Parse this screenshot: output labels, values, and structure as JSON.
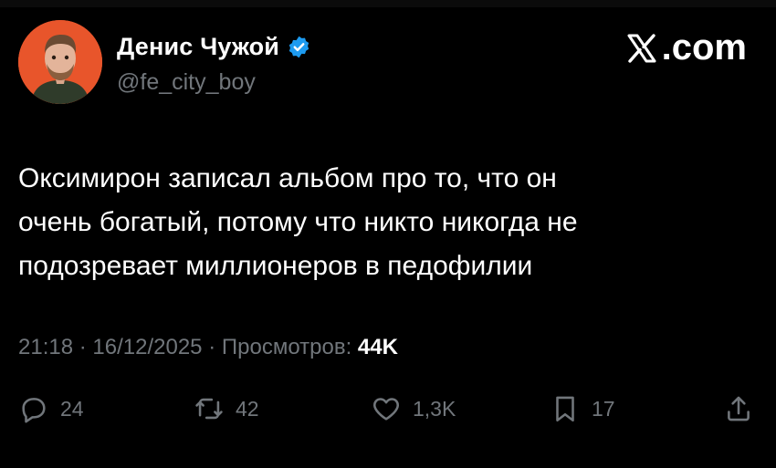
{
  "author": {
    "name": "Денис Чужой",
    "handle": "@fe_city_boy",
    "verified": true,
    "avatar_bg": "#e8552b"
  },
  "brand": {
    "domain_suffix": ".com",
    "icon": "x-logo-icon"
  },
  "tweet": {
    "lines": [
      "Оксимирон записал альбом про то, что он",
      "очень богатый, потому что никто никогда не",
      "подозревает миллионеров в педофилии"
    ]
  },
  "meta": {
    "time": "21:18",
    "separator": "·",
    "date": "16/12/2025",
    "views_label": "Просмотров:",
    "views_count": "44K"
  },
  "actions": {
    "replies": {
      "icon": "reply-icon",
      "count": "24"
    },
    "reposts": {
      "icon": "repost-icon",
      "count": "42"
    },
    "likes": {
      "icon": "heart-icon",
      "count": "1,3K"
    },
    "bookmarks": {
      "icon": "bookmark-icon",
      "count": "17"
    },
    "share": {
      "icon": "share-icon"
    }
  },
  "colors": {
    "background": "#000000",
    "text_primary": "#ffffff",
    "text_secondary": "#71767b",
    "verified_blue": "#1d9bf0"
  }
}
